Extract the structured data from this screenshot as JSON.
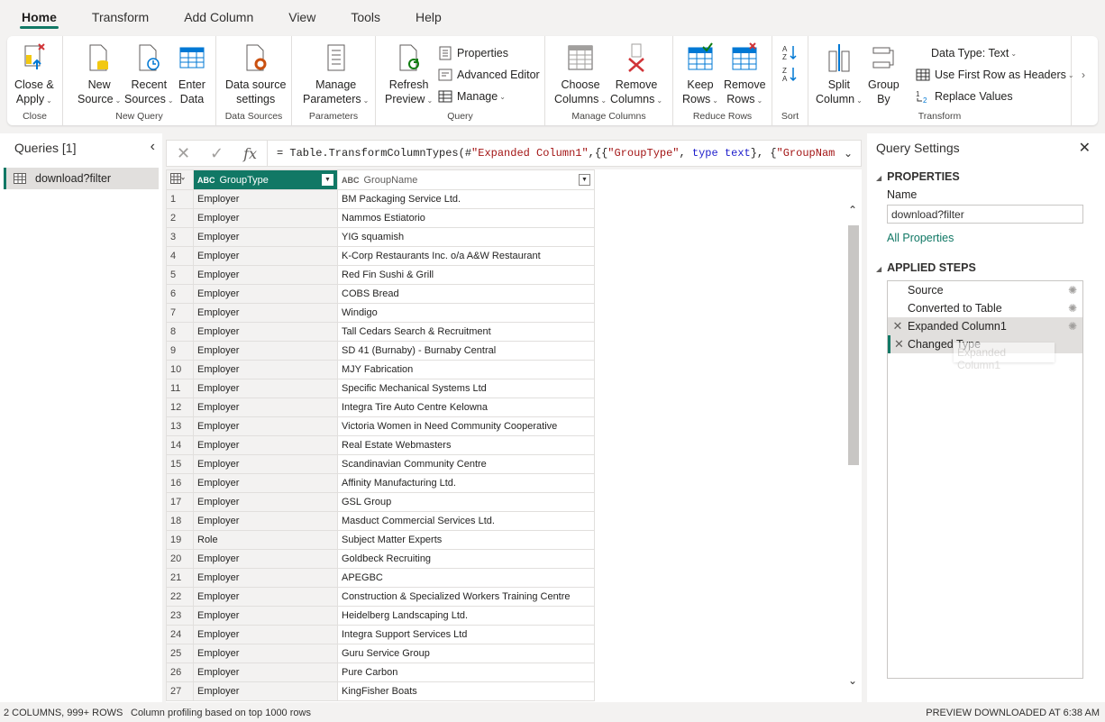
{
  "menu": {
    "tabs": [
      "Home",
      "Transform",
      "Add Column",
      "View",
      "Tools",
      "Help"
    ]
  },
  "ribbon": {
    "close_group": {
      "label": "Close",
      "close_apply_line1": "Close &",
      "close_apply_line2": "Apply"
    },
    "new_query_group": {
      "label": "New Query",
      "new_source_line1": "New",
      "new_source_line2": "Source",
      "recent_sources_line1": "Recent",
      "recent_sources_line2": "Sources",
      "enter_data_line1": "Enter",
      "enter_data_line2": "Data"
    },
    "data_sources_group": {
      "label": "Data Sources",
      "line1": "Data source",
      "line2": "settings"
    },
    "parameters_group": {
      "label": "Parameters",
      "line1": "Manage",
      "line2": "Parameters"
    },
    "query_group": {
      "label": "Query",
      "refresh_line1": "Refresh",
      "refresh_line2": "Preview",
      "properties": "Properties",
      "advanced_editor": "Advanced Editor",
      "manage": "Manage"
    },
    "manage_columns_group": {
      "label": "Manage Columns",
      "choose_line1": "Choose",
      "choose_line2": "Columns",
      "remove_line1": "Remove",
      "remove_line2": "Columns"
    },
    "reduce_rows_group": {
      "label": "Reduce Rows",
      "keep_line1": "Keep",
      "keep_line2": "Rows",
      "remove_line1": "Remove",
      "remove_line2": "Rows"
    },
    "sort_group": {
      "label": "Sort"
    },
    "transform_group": {
      "label": "Transform",
      "split_line1": "Split",
      "split_line2": "Column",
      "group_line1": "Group",
      "group_line2": "By",
      "data_type": "Data Type: Text",
      "first_row_headers": "Use First Row as Headers",
      "replace_values": "Replace Values"
    }
  },
  "queries_pane": {
    "title": "Queries [1]",
    "items": [
      "download?filter"
    ]
  },
  "formula_bar": {
    "p1": "= Table.TransformColumnTypes(#",
    "s1": "\"Expanded Column1\"",
    "p2": ",{{",
    "s2": "\"GroupType\"",
    "p3": ", ",
    "k1": "type text",
    "p4": "}, {",
    "s3": "\"GroupName\"",
    "p5": ","
  },
  "grid": {
    "columns": [
      {
        "name": "GroupType",
        "type_icon": "ABC"
      },
      {
        "name": "GroupName",
        "type_icon": "ABC"
      }
    ],
    "rows": [
      [
        "1",
        "Employer",
        "BM Packaging Service Ltd."
      ],
      [
        "2",
        "Employer",
        "Nammos Estiatorio"
      ],
      [
        "3",
        "Employer",
        "YIG squamish"
      ],
      [
        "4",
        "Employer",
        "K-Corp Restaurants Inc. o/a A&W Restaurant"
      ],
      [
        "5",
        "Employer",
        "Red Fin Sushi & Grill"
      ],
      [
        "6",
        "Employer",
        "COBS Bread"
      ],
      [
        "7",
        "Employer",
        "Windigo"
      ],
      [
        "8",
        "Employer",
        "Tall Cedars Search & Recruitment"
      ],
      [
        "9",
        "Employer",
        "SD 41 (Burnaby) - Burnaby Central"
      ],
      [
        "10",
        "Employer",
        "MJY Fabrication"
      ],
      [
        "11",
        "Employer",
        "Specific Mechanical Systems Ltd"
      ],
      [
        "12",
        "Employer",
        "Integra Tire Auto Centre Kelowna"
      ],
      [
        "13",
        "Employer",
        "Victoria Women in Need Community Cooperative"
      ],
      [
        "14",
        "Employer",
        "Real Estate Webmasters"
      ],
      [
        "15",
        "Employer",
        "Scandinavian Community Centre"
      ],
      [
        "16",
        "Employer",
        "Affinity Manufacturing Ltd."
      ],
      [
        "17",
        "Employer",
        "GSL Group"
      ],
      [
        "18",
        "Employer",
        "Masduct Commercial Services Ltd."
      ],
      [
        "19",
        "Role",
        "Subject Matter Experts"
      ],
      [
        "20",
        "Employer",
        "Goldbeck Recruiting"
      ],
      [
        "21",
        "Employer",
        "APEGBC"
      ],
      [
        "22",
        "Employer",
        "Construction & Specialized Workers Training Centre"
      ],
      [
        "23",
        "Employer",
        "Heidelberg Landscaping Ltd."
      ],
      [
        "24",
        "Employer",
        "Integra Support Services Ltd"
      ],
      [
        "25",
        "Employer",
        "Guru Service Group"
      ],
      [
        "26",
        "Employer",
        "Pure Carbon"
      ],
      [
        "27",
        "Employer",
        "KingFisher Boats"
      ]
    ]
  },
  "settings_pane": {
    "title": "Query Settings",
    "properties_title": "PROPERTIES",
    "name_label": "Name",
    "name_value": "download?filter",
    "all_properties": "All Properties",
    "applied_steps_title": "APPLIED STEPS",
    "steps": [
      "Source",
      "Converted to Table",
      "Expanded Column1",
      "Changed Type"
    ],
    "drag_ghost": "Expanded Column1"
  },
  "status_bar": {
    "left": "2 COLUMNS, 999+ ROWS",
    "middle": "Column profiling based on top 1000 rows",
    "right": "PREVIEW DOWNLOADED AT 6:38 AM"
  },
  "colors": {
    "accent": "#117865",
    "header_underline": "#2ec4b6"
  }
}
